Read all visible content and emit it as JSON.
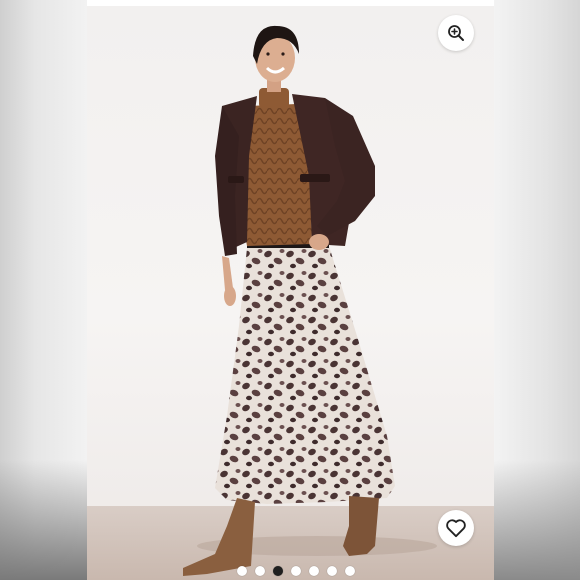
{
  "gallery": {
    "image_count": 7,
    "active_index": 2,
    "zoom_icon": "zoom-in-icon",
    "like_icon": "heart-icon"
  },
  "colors": {
    "jacket": "#3b2422",
    "sweater": "#8e5a34",
    "skirt_base": "#e9e1da",
    "skirt_print": "#4a3434",
    "boots": "#8a5f3f",
    "active_dot": "#1f1f1f"
  }
}
